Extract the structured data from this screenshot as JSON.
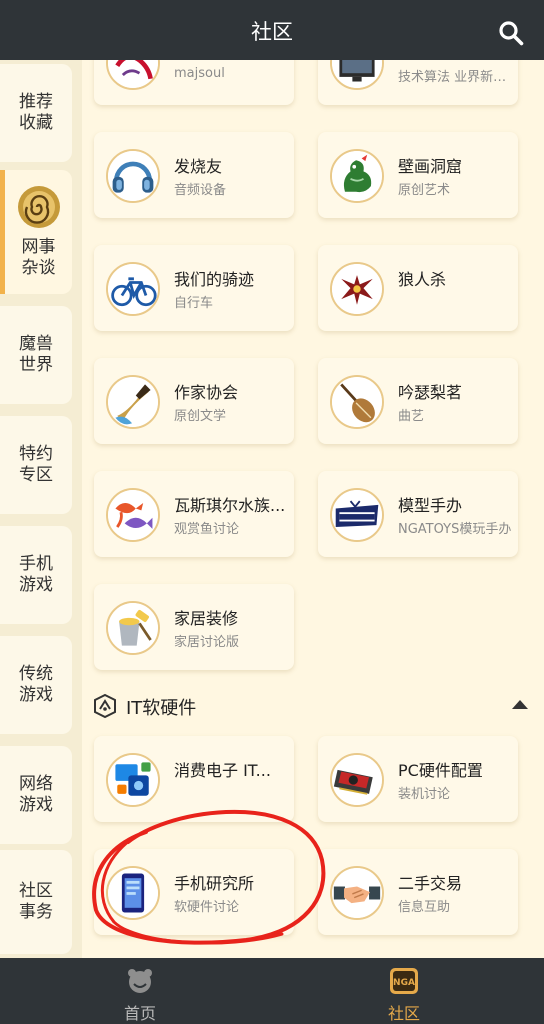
{
  "header": {
    "title": "社区"
  },
  "sidebar": {
    "items": [
      {
        "label": "推荐收藏"
      },
      {
        "label": "网事杂谈"
      },
      {
        "label": "魔兽世界"
      },
      {
        "label": "特约专区"
      },
      {
        "label": "手机游戏"
      },
      {
        "label": "传统游戏"
      },
      {
        "label": "网络游戏"
      },
      {
        "label": "社区事务"
      }
    ]
  },
  "boards": [
    {
      "title": "",
      "subtitle": "majsoul",
      "icon": "majsoul-icon"
    },
    {
      "title": "",
      "subtitle": "技术算法 业界新闻...",
      "icon": "monitor-icon"
    },
    {
      "title": "发烧友",
      "subtitle": "音频设备",
      "icon": "headphones-icon"
    },
    {
      "title": "壁画洞窟",
      "subtitle": "原创艺术",
      "icon": "dragon-icon"
    },
    {
      "title": "我们的骑迹",
      "subtitle": "自行车",
      "icon": "bicycle-icon"
    },
    {
      "title": "狼人杀",
      "subtitle": "",
      "icon": "werewolf-icon"
    },
    {
      "title": "作家协会",
      "subtitle": "原创文学",
      "icon": "pen-nib-icon"
    },
    {
      "title": "吟瑟梨茗",
      "subtitle": "曲艺",
      "icon": "pipa-icon"
    },
    {
      "title": "瓦斯琪尔水族...",
      "subtitle": "观赏鱼讨论",
      "icon": "fish-icon"
    },
    {
      "title": "模型手办",
      "subtitle": "NGATOYS模玩手办",
      "icon": "ngatoys-logo-icon"
    },
    {
      "title": "家居装修",
      "subtitle": "家居讨论版",
      "icon": "paint-bucket-icon"
    }
  ],
  "section": {
    "title": "IT软硬件"
  },
  "it_boards": [
    {
      "title": "消费电子 IT...",
      "subtitle": "",
      "icon": "electronics-icon"
    },
    {
      "title": "PC硬件配置",
      "subtitle": "装机讨论",
      "icon": "graphics-card-icon"
    },
    {
      "title": "手机研究所",
      "subtitle": "软硬件讨论",
      "icon": "smartphone-icon"
    },
    {
      "title": "二手交易",
      "subtitle": "信息互助",
      "icon": "handshake-icon"
    }
  ],
  "tabs": [
    {
      "label": "首页",
      "icon": "nga-bear-icon",
      "color": "#B9B9B9"
    },
    {
      "label": "社区",
      "icon": "nga-badge-icon",
      "color": "#E5A94A"
    }
  ],
  "colors": {
    "accent": "#F2B24B",
    "header": "#2F3438",
    "background": "#FFF7E1",
    "annotation": "#E8231B"
  }
}
